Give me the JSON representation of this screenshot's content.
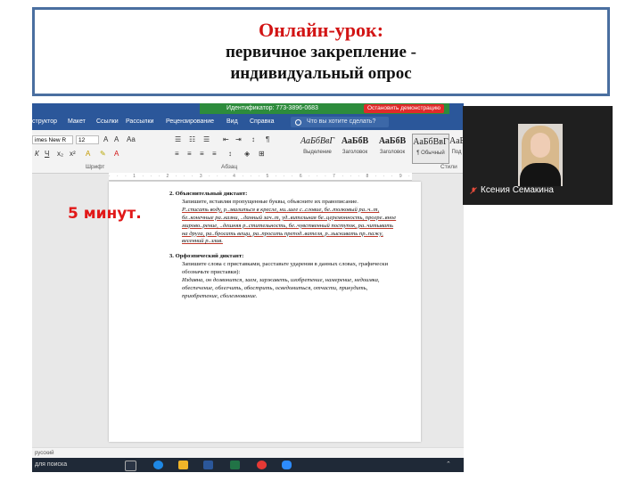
{
  "slide": {
    "title": "Онлайн-урок:",
    "subtitle_line1": "первичное закрепление -",
    "subtitle_line2": "индивидуальный опрос",
    "timer_note": "5 минут."
  },
  "zoom": {
    "identifier_text": "Идентификатор: 773-3896-0683",
    "stop_button": "Остановить демонстрацию"
  },
  "word": {
    "tabs": [
      "структор",
      "Макет",
      "Ссылки",
      "Рассылки",
      "Рецензирование",
      "Вид",
      "Справка"
    ],
    "search_placeholder": "Что вы хотите сделать?",
    "font_name": "imes New R",
    "font_size": "12",
    "groups": {
      "font": "Шрифт",
      "paragraph": "Абзац",
      "styles": "Стили"
    },
    "styles": [
      {
        "sample": "АаБбВвГ",
        "name": "Выделение"
      },
      {
        "sample": "АаБбВ",
        "name": "Заголовок"
      },
      {
        "sample": "АаБбВ",
        "name": "Заголовок"
      },
      {
        "sample": "АаБбВвГ",
        "name": "¶ Обычный"
      },
      {
        "sample": "АаБ",
        "name": "Под"
      }
    ],
    "status_language": "русский",
    "taskbar_search": "для поиска"
  },
  "document": {
    "section2_title": "2. Объяснительный диктант:",
    "section2_task": "Запишите, вставляя пропущенные буквы, объясните их правописание.",
    "section2_text": "Р..списать воду, р..звалиться в кресле, ни..шее с..словие, бе..толковый ра..ч..т, бе..конечные ра..казни, ..данный зач..т, уд..вительная бе..церемонность, прогре..вное мирово..рение, ..дешняя р..стительность, бе..чувственный поступок, ра..читывать на друга, ра..бросать вещи, ра..просить препод..вателя, р..зыскивать пр..пажу, весенний р..злив.",
    "section3_title": "3. Орфоэпический диктант:",
    "section3_task": "Запишите слова с приставками, расставьте ударения в данных словах, графически обозначьте приставки):",
    "section3_text": "Издавна, он дозвонится, заем, заржаветь, изобретение, намерение, недоимка, обеспечение, облегчить, обострить, осведомиться, отчасти, прикудить, приобретение, сболезнование."
  },
  "participant": {
    "name": "Ксения Семакина"
  }
}
